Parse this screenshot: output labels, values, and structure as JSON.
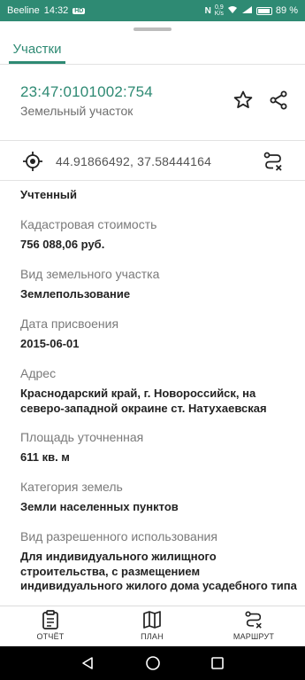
{
  "status_bar": {
    "carrier": "Beeline",
    "time": "14:32",
    "hd_badge": "HD",
    "speed_value": "0,9",
    "speed_unit": "K/s",
    "battery": "89 %"
  },
  "tabs": [
    {
      "label": "Участки",
      "active": true
    }
  ],
  "parcel": {
    "cadastral_number": "23:47:0101002:754",
    "type": "Земельный участок",
    "coordinates": "44.91866492, 37.58444164",
    "status": "Учтенный"
  },
  "fields": [
    {
      "label": "Кадастровая стоимость",
      "value": "756 088,06 руб."
    },
    {
      "label": "Вид земельного участка",
      "value": "Землепользование"
    },
    {
      "label": "Дата присвоения",
      "value": "2015-06-01"
    },
    {
      "label": "Адрес",
      "value": "Краснодарский край, г. Новороссийск, на северо-западной окраине ст. Натухаевская"
    },
    {
      "label": "Площадь уточненная",
      "value": "611 кв. м"
    },
    {
      "label": "Категория земель",
      "value": "Земли населенных пунктов"
    },
    {
      "label": "Вид разрешенного использования",
      "value": "Для индивидуального жилищного строительства, с размещением индивидуального жилого дома усадебного типа"
    }
  ],
  "bottom_nav": {
    "report": "ОТЧЁТ",
    "plan": "ПЛАН",
    "route": "МАРШРУТ"
  },
  "colors": {
    "accent": "#2e8a73",
    "label": "#7a7a7a",
    "value": "#222222"
  },
  "icons": [
    "star-icon",
    "share-icon",
    "target-icon",
    "route-icon",
    "report-icon",
    "map-icon",
    "back-icon",
    "home-icon",
    "recents-icon"
  ]
}
